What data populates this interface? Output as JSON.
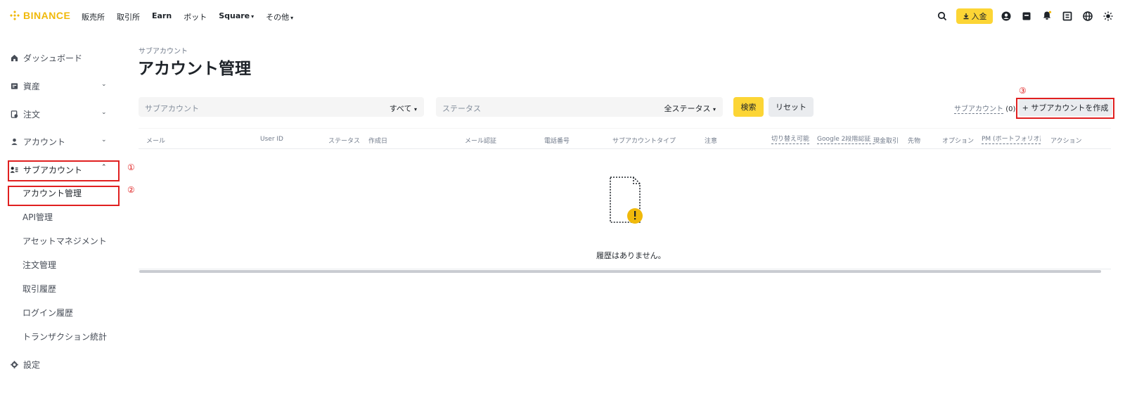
{
  "brand": {
    "name": "BINANCE",
    "color": "#f0b90b"
  },
  "topnav": {
    "items": [
      {
        "label": "販売所",
        "bold": false,
        "dropdown": false
      },
      {
        "label": "取引所",
        "bold": false,
        "dropdown": false
      },
      {
        "label": "Earn",
        "bold": true,
        "dropdown": false
      },
      {
        "label": "ボット",
        "bold": false,
        "dropdown": false
      },
      {
        "label": "Square",
        "bold": true,
        "dropdown": true
      },
      {
        "label": "その他",
        "bold": false,
        "dropdown": true
      }
    ],
    "deposit_label": "入金",
    "icons": [
      "search-icon",
      "download-icon",
      "profile-icon",
      "wallet-icon",
      "bell-icon",
      "scan-icon",
      "globe-icon",
      "theme-icon"
    ]
  },
  "sidebar": {
    "items": [
      {
        "label": "ダッシュボード",
        "icon": "home-icon",
        "chevron": false
      },
      {
        "label": "資産",
        "icon": "wallet-icon",
        "chevron": true
      },
      {
        "label": "注文",
        "icon": "order-icon",
        "chevron": true
      },
      {
        "label": "アカウント",
        "icon": "user-icon",
        "chevron": true
      },
      {
        "label": "サブアカウント",
        "icon": "sub-account-icon",
        "chevron": true,
        "expanded": true
      },
      {
        "label": "設定",
        "icon": "gear-icon",
        "chevron": false
      }
    ],
    "subitems": [
      {
        "label": "アカウント管理",
        "active": true
      },
      {
        "label": "API管理"
      },
      {
        "label": "アセットマネジメント"
      },
      {
        "label": "注文管理"
      },
      {
        "label": "取引履歴"
      },
      {
        "label": "ログイン履歴"
      },
      {
        "label": "トランザクション統計"
      }
    ]
  },
  "annotations": {
    "a1": "①",
    "a2": "②",
    "a3": "③"
  },
  "page": {
    "breadcrumb": "サブアカウント",
    "title": "アカウント管理"
  },
  "filters": {
    "subaccount_placeholder": "サブアカウント",
    "subaccount_select": "すべて",
    "status_placeholder": "ステータス",
    "status_select": "全ステータス",
    "search_label": "検索",
    "reset_label": "リセット"
  },
  "summary": {
    "subaccount_label": "サブアカウント",
    "count": "(0)",
    "create_label": "+ サブアカウントを作成"
  },
  "table": {
    "columns": [
      "メール",
      "User ID",
      "ステータス",
      "作成日",
      "メール認証",
      "電話番号",
      "サブアカウントタイプ",
      "注意",
      "切り替え可能",
      "Google 2段階認証",
      "現金取引",
      "先物",
      "オプション",
      "PM (ポートフォリオ証",
      "アクション"
    ],
    "empty_message": "履歴はありません。"
  },
  "colors": {
    "accent": "#fcd535",
    "highlight": "#e02020",
    "text": "#1e2329",
    "muted": "#707a8a"
  }
}
